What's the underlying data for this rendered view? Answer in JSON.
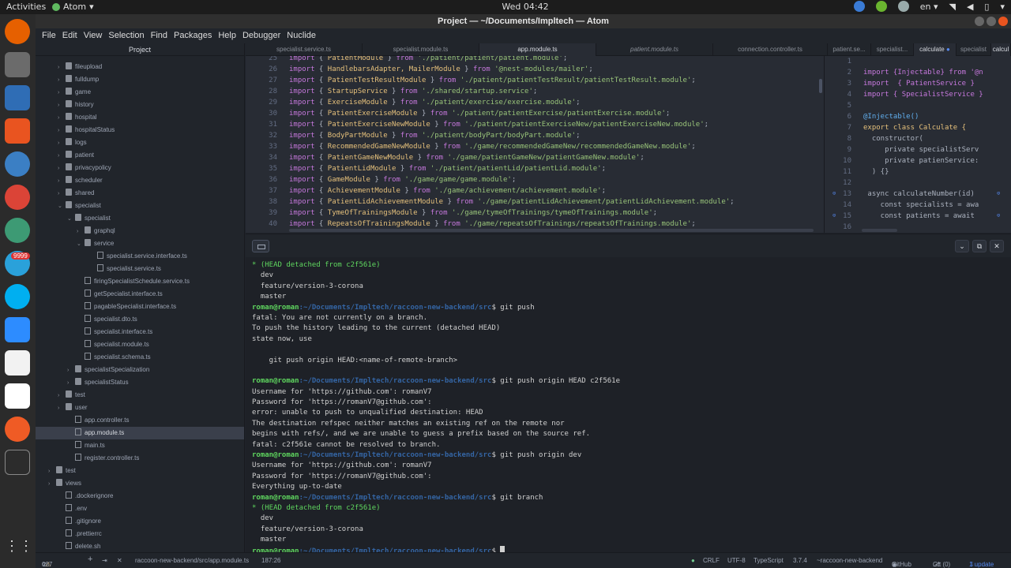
{
  "topbar": {
    "activities": "Activities",
    "app_name": "Atom",
    "app_menu_arrow": "▾",
    "clock": "Wed 04:42",
    "lang": "en",
    "lang_arrow": "▾"
  },
  "window": {
    "title": "Project — ~/Documents/Impltech — Atom"
  },
  "dock": {
    "telegram_badge": "9999"
  },
  "menu": [
    "File",
    "Edit",
    "View",
    "Selection",
    "Find",
    "Packages",
    "Help",
    "Debugger",
    "Nuclide"
  ],
  "tree": {
    "header": "Project",
    "rows": [
      {
        "label": "fileupload",
        "arrow": "›",
        "type": "dir"
      },
      {
        "label": "fulldump",
        "arrow": "›",
        "type": "dir"
      },
      {
        "label": "game",
        "arrow": "›",
        "type": "dir"
      },
      {
        "label": "history",
        "arrow": "›",
        "type": "dir"
      },
      {
        "label": "hospital",
        "arrow": "›",
        "type": "dir"
      },
      {
        "label": "hospitalStatus",
        "arrow": "›",
        "type": "dir"
      },
      {
        "label": "logs",
        "arrow": "›",
        "type": "dir"
      },
      {
        "label": "patient",
        "arrow": "›",
        "type": "dir"
      },
      {
        "label": "privacypolicy",
        "arrow": "›",
        "type": "dir"
      },
      {
        "label": "scheduler",
        "arrow": "›",
        "type": "dir"
      },
      {
        "label": "shared",
        "arrow": "›",
        "type": "dir"
      },
      {
        "label": "specialist",
        "arrow": "⌄",
        "type": "dir"
      },
      {
        "label": "specialist",
        "arrow": "⌄",
        "type": "dir"
      },
      {
        "label": "graphql",
        "arrow": "›",
        "type": "dir"
      },
      {
        "label": "service",
        "arrow": "⌄",
        "type": "dir"
      },
      {
        "label": "specialist.service.interface.ts",
        "arrow": "",
        "type": "file"
      },
      {
        "label": "specialist.service.ts",
        "arrow": "",
        "type": "file"
      },
      {
        "label": "firingSpecialistSchedule.service.ts",
        "arrow": "",
        "type": "file"
      },
      {
        "label": "getSpecialist.interface.ts",
        "arrow": "",
        "type": "file"
      },
      {
        "label": "pagableSpecialist.interface.ts",
        "arrow": "",
        "type": "file"
      },
      {
        "label": "specialist.dto.ts",
        "arrow": "",
        "type": "file"
      },
      {
        "label": "specialist.interface.ts",
        "arrow": "",
        "type": "file"
      },
      {
        "label": "specialist.module.ts",
        "arrow": "",
        "type": "file"
      },
      {
        "label": "specialist.schema.ts",
        "arrow": "",
        "type": "file"
      },
      {
        "label": "specialistSpecialization",
        "arrow": "›",
        "type": "dir"
      },
      {
        "label": "specialistStatus",
        "arrow": "›",
        "type": "dir"
      },
      {
        "label": "test",
        "arrow": "›",
        "type": "dir"
      },
      {
        "label": "user",
        "arrow": "›",
        "type": "dir"
      },
      {
        "label": "app.controller.ts",
        "arrow": "",
        "type": "file"
      },
      {
        "label": "app.module.ts",
        "arrow": "",
        "type": "file"
      },
      {
        "label": "main.ts",
        "arrow": "",
        "type": "file"
      },
      {
        "label": "register.controller.ts",
        "arrow": "",
        "type": "file"
      },
      {
        "label": "test",
        "arrow": "›",
        "type": "dir"
      },
      {
        "label": "views",
        "arrow": "›",
        "type": "dir"
      },
      {
        "label": ".dockerignore",
        "arrow": "",
        "type": "file"
      },
      {
        "label": ".env",
        "arrow": "",
        "type": "file"
      },
      {
        "label": ".gitignore",
        "arrow": "",
        "type": "file"
      },
      {
        "label": ".prettierrc",
        "arrow": "",
        "type": "file"
      },
      {
        "label": "delete.sh",
        "arrow": "",
        "type": "file"
      }
    ]
  },
  "tabs": [
    {
      "label": "specialist.service.ts",
      "modified": ""
    },
    {
      "label": "specialist.module.ts",
      "modified": ""
    },
    {
      "label": "app.module.ts",
      "modified": ""
    },
    {
      "label": "patient.module.ts",
      "modified": ""
    },
    {
      "label": "connection.controller.ts",
      "modified": ""
    },
    {
      "label": "patient.se...",
      "modified": ""
    },
    {
      "label": "specialist...",
      "modified": ""
    },
    {
      "label": "calculate",
      "modified": "●"
    },
    {
      "label": "specialist",
      "modified": ""
    },
    {
      "label": "calcul",
      "modified": ""
    }
  ],
  "editor": {
    "lines": [
      {
        "n": "25",
        "mod": "PatientModule",
        "path": "'./patient/patient/patient.module'"
      },
      {
        "n": "26",
        "mod": "HandlebarsAdapter, MailerModule",
        "path": "'@nest-modules/mailer'"
      },
      {
        "n": "27",
        "mod": "PatientTestResultModule",
        "path": "'./patient/patientTestResult/patientTestResult.module'"
      },
      {
        "n": "28",
        "mod": "StartupService",
        "path": "'./shared/startup.service'"
      },
      {
        "n": "29",
        "mod": "ExerciseModule",
        "path": "'./patient/exercise/exercise.module'"
      },
      {
        "n": "30",
        "mod": "PatientExerciseModule",
        "path": "'./patient/patientExercise/patientExercise.module'"
      },
      {
        "n": "31",
        "mod": "PatientExerciseNewModule",
        "path": "'./patient/patientExerciseNew/patientExerciseNew.module'"
      },
      {
        "n": "32",
        "mod": "BodyPartModule",
        "path": "'./patient/bodyPart/bodyPart.module'"
      },
      {
        "n": "33",
        "mod": "RecommendedGameNewModule",
        "path": "'./game/recommendedGameNew/recommendedGameNew.module'"
      },
      {
        "n": "34",
        "mod": "PatientGameNewModule",
        "path": "'./game/patientGameNew/patientGameNew.module'"
      },
      {
        "n": "35",
        "mod": "PatientLidModule",
        "path": "'./patient/patientLid/patientLid.module'"
      },
      {
        "n": "36",
        "mod": "GameModule",
        "path": "'./game/game/game.module'"
      },
      {
        "n": "37",
        "mod": "AchievementModule",
        "path": "'./game/achievement/achievement.module'"
      },
      {
        "n": "38",
        "mod": "PatientLidAchievementModule",
        "path": "'./game/patientLidAchievement/patientLidAchievement.module'"
      },
      {
        "n": "39",
        "mod": "TymeOfTrainingsModule",
        "path": "'./game/tymeOfTrainings/tymeOfTrainings.module'"
      },
      {
        "n": "40",
        "mod": "RepeatsOfTrainingsModule",
        "path": "'./game/repeatsOfTrainings/repeatsOfTrainings.module'"
      }
    ],
    "kw_import": "import",
    "kw_from": "from"
  },
  "editor2": {
    "lines": [
      {
        "n": "1",
        "text": ""
      },
      {
        "n": "2",
        "text": "import {Injectable} from '@n"
      },
      {
        "n": "3",
        "text": "import  { PatientService }"
      },
      {
        "n": "4",
        "text": "import { SpecialistService }"
      },
      {
        "n": "5",
        "text": ""
      },
      {
        "n": "6",
        "text": "@Injectable()"
      },
      {
        "n": "7",
        "text": "export class Calculate {"
      },
      {
        "n": "8",
        "text": "  constructor("
      },
      {
        "n": "9",
        "text": "     private specialistServ"
      },
      {
        "n": "10",
        "text": "     private patienService:"
      },
      {
        "n": "11",
        "text": "  ) {}"
      },
      {
        "n": "12",
        "text": ""
      },
      {
        "n": "13",
        "text": " async calculateNumber(id) "
      },
      {
        "n": "14",
        "text": "    const specialists = awa"
      },
      {
        "n": "15",
        "text": "    const patients = await "
      },
      {
        "n": "16",
        "text": ""
      }
    ],
    "gutter_mark": "⊙"
  },
  "terminal": {
    "header_controls": [
      "⌄",
      "⧉",
      "✕"
    ],
    "prompt_user": "roman@roman",
    "prompt_path": ":~/Documents/Impltech/raccoon-new-backend/src",
    "lines": [
      {
        "kind": "green",
        "text": "* (HEAD detached from c2f561e)"
      },
      {
        "kind": "plain",
        "text": "  dev"
      },
      {
        "kind": "plain",
        "text": "  feature/version-3-corona"
      },
      {
        "kind": "plain",
        "text": "  master"
      },
      {
        "kind": "prompt",
        "text": "$ git push"
      },
      {
        "kind": "plain",
        "text": "fatal: You are not currently on a branch."
      },
      {
        "kind": "plain",
        "text": "To push the history leading to the current (detached HEAD)"
      },
      {
        "kind": "plain",
        "text": "state now, use"
      },
      {
        "kind": "plain",
        "text": ""
      },
      {
        "kind": "plain",
        "text": "    git push origin HEAD:<name-of-remote-branch>"
      },
      {
        "kind": "plain",
        "text": ""
      },
      {
        "kind": "prompt",
        "text": "$ git push origin HEAD c2f561e"
      },
      {
        "kind": "plain",
        "text": "Username for 'https://github.com': romanV7"
      },
      {
        "kind": "plain",
        "text": "Password for 'https://romanV7@github.com':"
      },
      {
        "kind": "plain",
        "text": "error: unable to push to unqualified destination: HEAD"
      },
      {
        "kind": "plain",
        "text": "The destination refspec neither matches an existing ref on the remote nor"
      },
      {
        "kind": "plain",
        "text": "begins with refs/, and we are unable to guess a prefix based on the source ref."
      },
      {
        "kind": "plain",
        "text": "fatal: c2f561e cannot be resolved to branch."
      },
      {
        "kind": "prompt",
        "text": "$ git push origin dev"
      },
      {
        "kind": "plain",
        "text": "Username for 'https://github.com': romanV7"
      },
      {
        "kind": "plain",
        "text": "Password for 'https://romanV7@github.com':"
      },
      {
        "kind": "plain",
        "text": "Everything up-to-date"
      },
      {
        "kind": "prompt",
        "text": "$ git branch"
      },
      {
        "kind": "green",
        "text": "* (HEAD detached from c2f561e)"
      },
      {
        "kind": "plain",
        "text": "  dev"
      },
      {
        "kind": "plain",
        "text": "  feature/version-3-corona"
      },
      {
        "kind": "plain",
        "text": "  master"
      },
      {
        "kind": "promptcur",
        "text": "$ "
      }
    ]
  },
  "status": {
    "errors": "0",
    "warnings": "37",
    "path": "raccoon-new-backend/src/app.module.ts",
    "cursor": "187:26",
    "line_ending": "CRLF",
    "encoding": "UTF-8",
    "grammar": "TypeScript",
    "ts_version": "3.7.4",
    "project": "~raccoon-new-backend",
    "github": "GitHub",
    "git": "Git (0)",
    "update": "1 update"
  }
}
